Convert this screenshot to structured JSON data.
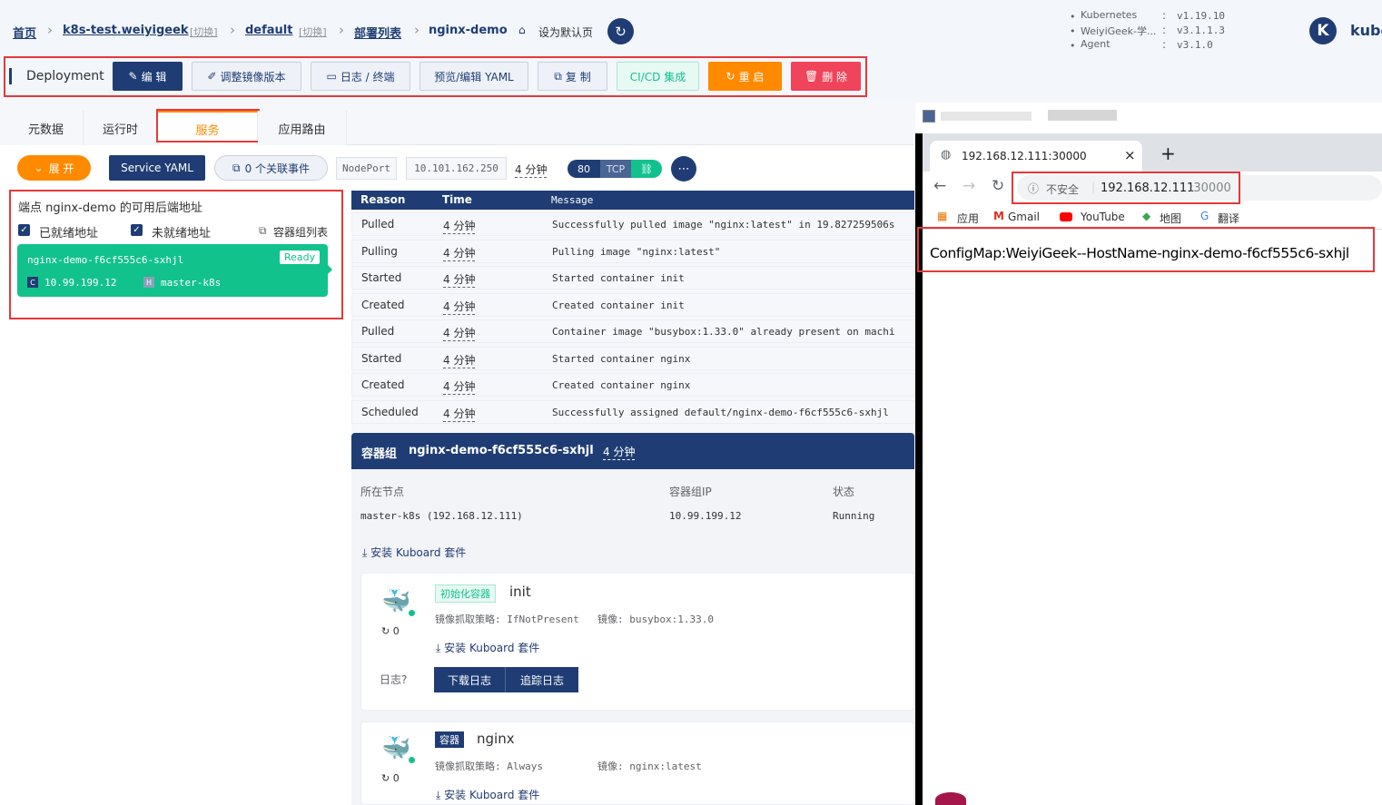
{
  "breadcrumb": {
    "home": "首页",
    "cluster": "k8s-test.weiyigeek",
    "cluster_switch": "[切换]",
    "namespace": "default",
    "namespace_switch": "[切换]",
    "deploy_list": "部署列表",
    "deploy_name": "nginx-demo",
    "set_default": "设为默认页"
  },
  "versions": [
    {
      "label": "Kubernetes",
      "value": "v1.19.10"
    },
    {
      "label": "WeiyiGeek-学...",
      "value": "v3.1.1.3"
    },
    {
      "label": "Agent",
      "value": "v3.1.0"
    }
  ],
  "brand": {
    "logo_letter": "K",
    "name": "kubo"
  },
  "toolbar": {
    "kind": "Deployment",
    "edit": "编 辑",
    "adjust_image": "调整镜像版本",
    "logs": "日志 / 终端",
    "yaml": "预览/编辑 YAML",
    "copy": "复 制",
    "cicd": "CI/CD 集成",
    "restart": "重 启",
    "delete": "删 除"
  },
  "tabs": [
    "元数据",
    "运行时",
    "服务",
    "应用路由"
  ],
  "service_bar": {
    "expand": "展 开",
    "service_yaml": "Service YAML",
    "events": "0 个关联事件",
    "type": "NodePort",
    "cluster_ip": "10.101.162.250",
    "age": "4 分钟",
    "port": "80",
    "protocol": "TCP"
  },
  "endpoints": {
    "title": "端点 nginx-demo 的可用后端地址",
    "ready_label": "已就绪地址",
    "not_ready_label": "未就绪地址",
    "pod_list": "容器组列表",
    "pod_name": "nginx-demo-f6cf555c6-sxhjl",
    "status": "Ready",
    "pod_ip": "10.99.199.12",
    "node": "master-k8s",
    "c_badge": "C",
    "h_badge": "H"
  },
  "events_table": {
    "headers": [
      "Reason",
      "Time",
      "Message"
    ],
    "rows": [
      {
        "reason": "Pulled",
        "time": "4 分钟",
        "message": "Successfully pulled image \"nginx:latest\" in 19.827259506s"
      },
      {
        "reason": "Pulling",
        "time": "4 分钟",
        "message": "Pulling image \"nginx:latest\""
      },
      {
        "reason": "Started",
        "time": "4 分钟",
        "message": "Started container init"
      },
      {
        "reason": "Created",
        "time": "4 分钟",
        "message": "Created container init"
      },
      {
        "reason": "Pulled",
        "time": "4 分钟",
        "message": "Container image \"busybox:1.33.0\" already present on machi"
      },
      {
        "reason": "Started",
        "time": "4 分钟",
        "message": "Started container nginx"
      },
      {
        "reason": "Created",
        "time": "4 分钟",
        "message": "Created container nginx"
      },
      {
        "reason": "Scheduled",
        "time": "4 分钟",
        "message": "Successfully assigned default/nginx-demo-f6cf555c6-sxhjl"
      }
    ]
  },
  "pod_panel": {
    "title_prefix": "容器组",
    "pod_name": "nginx-demo-f6cf555c6-sxhjl",
    "age": "4 分钟",
    "node_label": "所在节点",
    "node_value": "master-k8s  (192.168.12.111)",
    "ip_label": "容器组IP",
    "ip_value": "10.99.199.12",
    "status_label": "状态",
    "status_value": "Running",
    "install_suite": "安装 Kuboard 套件"
  },
  "containers": [
    {
      "badge": "初始化容器",
      "name": "init",
      "pull_policy": "镜像抓取策略: IfNotPresent",
      "image": "镜像: busybox:1.33.0",
      "restarts": "0",
      "install_suite": "安装 Kuboard 套件",
      "logs_label": "日志",
      "download_logs": "下载日志",
      "follow_logs": "追踪日志"
    },
    {
      "badge": "容器",
      "name": "nginx",
      "pull_policy": "镜像抓取策略: Always",
      "image": "镜像: nginx:latest",
      "restarts": "0",
      "install_suite": "安装 Kuboard 套件"
    }
  ],
  "browser": {
    "tab_title": "192.168.12.111:30000",
    "close": "×",
    "new_tab": "+",
    "insecure": "不安全",
    "url_host": "192.168.12.111",
    "url_port": ":30000",
    "bookmarks": [
      "应用",
      "Gmail",
      "YouTube",
      "地图",
      "翻译"
    ],
    "page_text": "ConfigMap:WeiyiGeek--HostName-nginx-demo-f6cf555c6-sxhjl"
  },
  "colors": {
    "navy": "#1f3d74",
    "green": "#12c28c",
    "orange": "#ff8a00",
    "red": "#f0445a",
    "highlight": "#e5393a"
  }
}
